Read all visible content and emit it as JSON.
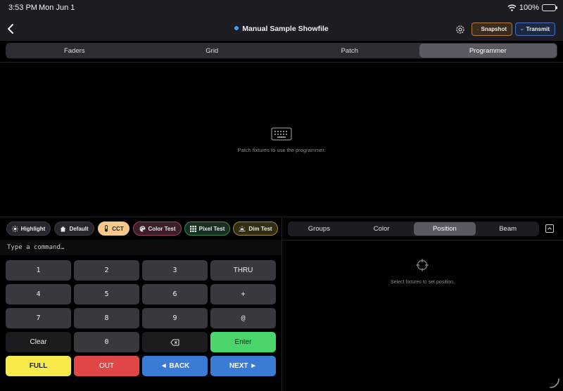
{
  "status": {
    "time": "3:53 PM",
    "date": "Mon Jun 1",
    "battery": "100%"
  },
  "header": {
    "title": "Manual Sample Showfile",
    "snapshot_label": "Snapshot",
    "transmit_label": "Transmit"
  },
  "tabs": [
    {
      "label": "Faders",
      "active": false
    },
    {
      "label": "Grid",
      "active": false
    },
    {
      "label": "Patch",
      "active": false
    },
    {
      "label": "Programmer",
      "active": true
    }
  ],
  "main": {
    "empty_message": "Patch fixtures to use the programmer."
  },
  "chips": {
    "highlight": "Highlight",
    "default": "Default",
    "cct": "CCT",
    "color_test": "Color Test",
    "pixel_test": "Pixel Test",
    "dim_test": "Dim Test"
  },
  "attributes": [
    {
      "label": "Groups",
      "active": false
    },
    {
      "label": "Color",
      "active": false
    },
    {
      "label": "Position",
      "active": true
    },
    {
      "label": "Beam",
      "active": false
    }
  ],
  "command": {
    "placeholder": "Type a command…",
    "value": ""
  },
  "keypad": {
    "k1": "1",
    "k2": "2",
    "k3": "3",
    "thru": "THRU",
    "k4": "4",
    "k5": "5",
    "k6": "6",
    "plus": "+",
    "k7": "7",
    "k8": "8",
    "k9": "9",
    "at": "@",
    "clear": "Clear",
    "k0": "0",
    "enter": "Enter",
    "full": "FULL",
    "out": "OUT",
    "back": "◄ BACK",
    "next": "NEXT ►"
  },
  "position_panel": {
    "empty_message": "Select fixtures to set position."
  },
  "colors": {
    "snapshot_accent": "#b27d3f",
    "transmit_accent": "#4a6fc1",
    "title_dot": "#3fa2f7",
    "enter": "#4ad56d",
    "full": "#f7ea4a",
    "out": "#e14646",
    "nav": "#3a7bd5"
  }
}
